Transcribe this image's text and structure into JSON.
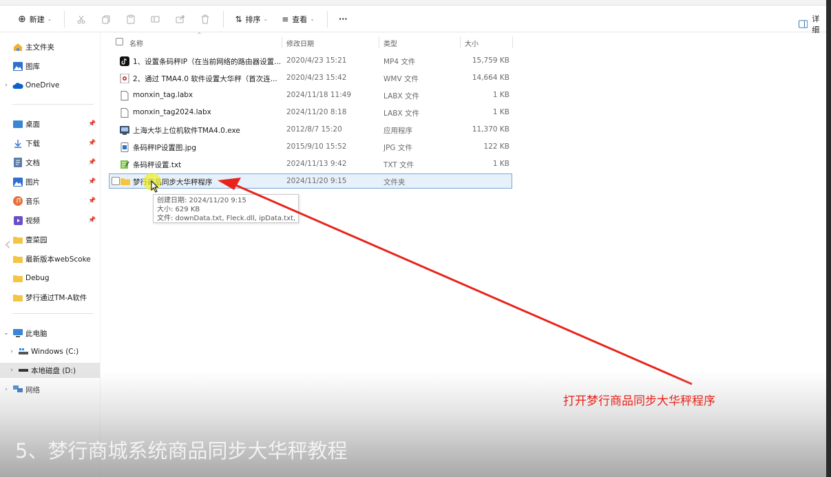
{
  "toolbar": {
    "new_label": "新建",
    "sort_label": "排序",
    "view_label": "查看",
    "more_label": "···",
    "detail_label": "详细"
  },
  "sidebar": {
    "home": "主文件夹",
    "gallery": "图库",
    "onedrive": "OneDrive",
    "quick": [
      {
        "label": "桌面"
      },
      {
        "label": "下载"
      },
      {
        "label": "文档"
      },
      {
        "label": "图片"
      },
      {
        "label": "音乐"
      },
      {
        "label": "视频"
      },
      {
        "label": "壹菜园"
      },
      {
        "label": "最新版本webScoke"
      },
      {
        "label": "Debug"
      },
      {
        "label": "梦行通过TM-A软件"
      }
    ],
    "this_pc": "此电脑",
    "drive_c": "Windows (C:)",
    "drive_d": "本地磁盘 (D:)",
    "network": "网络"
  },
  "columns": {
    "name": "名称",
    "date": "修改日期",
    "type": "类型",
    "size": "大小"
  },
  "files": [
    {
      "name": "1、设置条码秤IP（在当前网络的路由器设置...",
      "date": "2020/4/23 15:21",
      "type": "MP4 文件",
      "size": "15,759 KB",
      "icon": "tiktok-icon"
    },
    {
      "name": "2、通过 TMA4.0 软件设置大华秤（首次连...",
      "date": "2020/4/23 15:42",
      "type": "WMV 文件",
      "size": "14,664 KB",
      "icon": "video-file-icon"
    },
    {
      "name": "monxin_tag.labx",
      "date": "2024/11/18 11:49",
      "type": "LABX 文件",
      "size": "1 KB",
      "icon": "blank-file-icon"
    },
    {
      "name": "monxin_tag2024.labx",
      "date": "2024/11/20 8:18",
      "type": "LABX 文件",
      "size": "1 KB",
      "icon": "blank-file-icon"
    },
    {
      "name": "上海大华上位机软件TMA4.0.exe",
      "date": "2012/8/7 15:20",
      "type": "应用程序",
      "size": "11,370 KB",
      "icon": "exe-icon"
    },
    {
      "name": "条码秤IP设置图.jpg",
      "date": "2015/9/10 15:52",
      "type": "JPG 文件",
      "size": "122 KB",
      "icon": "image-file-icon"
    },
    {
      "name": "条码秤设置.txt",
      "date": "2024/11/13 9:42",
      "type": "TXT 文件",
      "size": "1 KB",
      "icon": "text-file-icon"
    },
    {
      "name": "梦行商品同步大华秤程序",
      "date": "2024/11/20 9:15",
      "type": "文件夹",
      "size": "",
      "icon": "folder-icon"
    }
  ],
  "tooltip": {
    "created": "创建日期: 2024/11/20 9:15",
    "size": "大小: 629 KB",
    "files": "文件: downData.txt, Fleck.dll, ipData.txt, ..."
  },
  "annotation": "打开梦行商品同步大华秤程序",
  "caption": "5、梦行商城系统商品同步大华秤教程",
  "colors": {
    "annotation_red": "#e8231b",
    "folder_yellow": "#f4c542",
    "selection_blue": "#7aa7d6"
  }
}
